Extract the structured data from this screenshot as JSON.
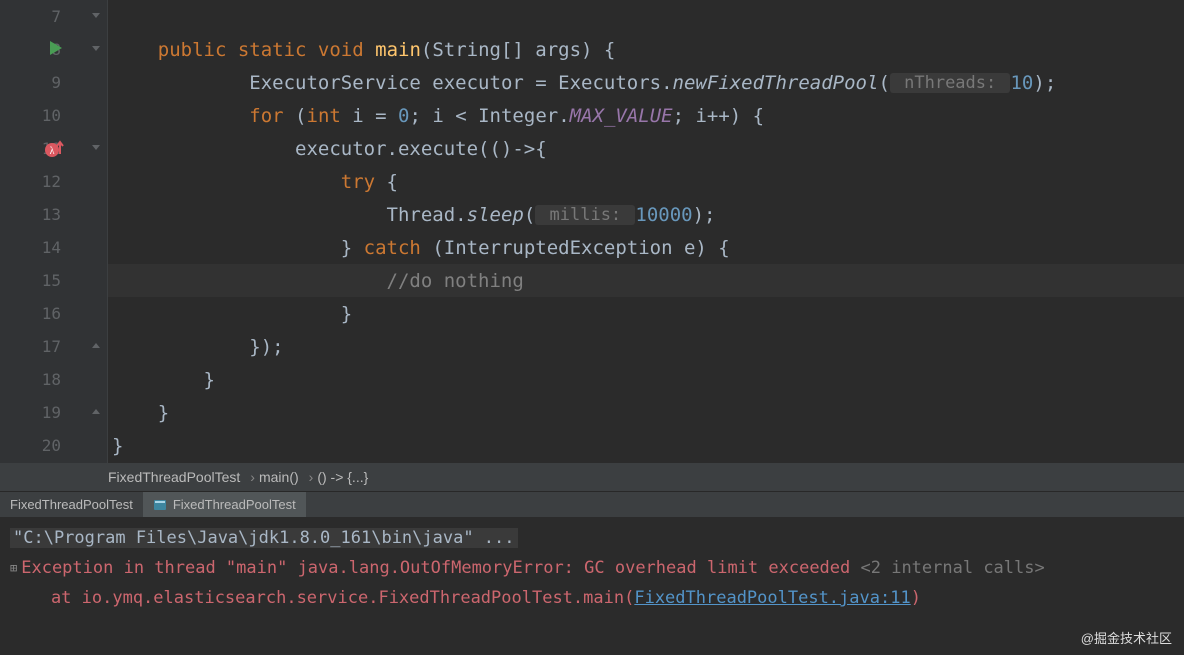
{
  "lines": {
    "start": 7,
    "end": 20
  },
  "code": {
    "l8": {
      "pre": "    ",
      "kw1": "public ",
      "kw2": "static ",
      "kw3": "void ",
      "method": "main",
      "sig": "(String[] args) {"
    },
    "l9": {
      "pre": "            ",
      "t1": "ExecutorService executor = Executors.",
      "call": "newFixedThreadPool",
      "open": "(",
      "hint": " nThreads: ",
      "val": "10",
      "close": ");"
    },
    "l10": {
      "pre": "            ",
      "kw": "for ",
      "t1": "(",
      "kw2": "int ",
      "t2": "i = ",
      "n0": "0",
      "t3": "; i < Integer.",
      "const": "MAX_VALUE",
      "t4": "; i++) {"
    },
    "l11": {
      "pre": "                ",
      "t1": "executor.execute(()->{"
    },
    "l12": {
      "pre": "                    ",
      "kw": "try ",
      "t": "{"
    },
    "l13": {
      "pre": "                        ",
      "t1": "Thread.",
      "call": "sleep",
      "open": "(",
      "hint": " millis: ",
      "val": "10000",
      "close": ");"
    },
    "l14": {
      "pre": "                    ",
      "t1": "} ",
      "kw": "catch ",
      "t2": "(InterruptedException e) {"
    },
    "l15": {
      "pre": "                        ",
      "comment": "//do nothing"
    },
    "l16": {
      "pre": "                    ",
      "t": "}"
    },
    "l17": {
      "pre": "            ",
      "t": "});"
    },
    "l18": {
      "pre": "        ",
      "t": "}"
    },
    "l19": {
      "pre": "    ",
      "t": "}"
    },
    "l20": {
      "pre": "",
      "t": "}"
    }
  },
  "breadcrumb": {
    "b1": "FixedThreadPoolTest",
    "b2": "main()",
    "b3": "() -> {...}"
  },
  "tabs": {
    "t1": "FixedThreadPoolTest",
    "t2": "FixedThreadPoolTest"
  },
  "console": {
    "cmd": "\"C:\\Program Files\\Java\\jdk1.8.0_161\\bin\\java\" ...",
    "err": "Exception in thread \"main\" java.lang.OutOfMemoryError: GC overhead limit exceeded",
    "hint": " <2 internal calls>",
    "trace_pre": "    at io.ymq.elasticsearch.service.FixedThreadPoolTest.main",
    "trace_open": "(",
    "trace_link": "FixedThreadPoolTest.java:11",
    "trace_close": ")"
  },
  "watermark": "@掘金技术社区"
}
